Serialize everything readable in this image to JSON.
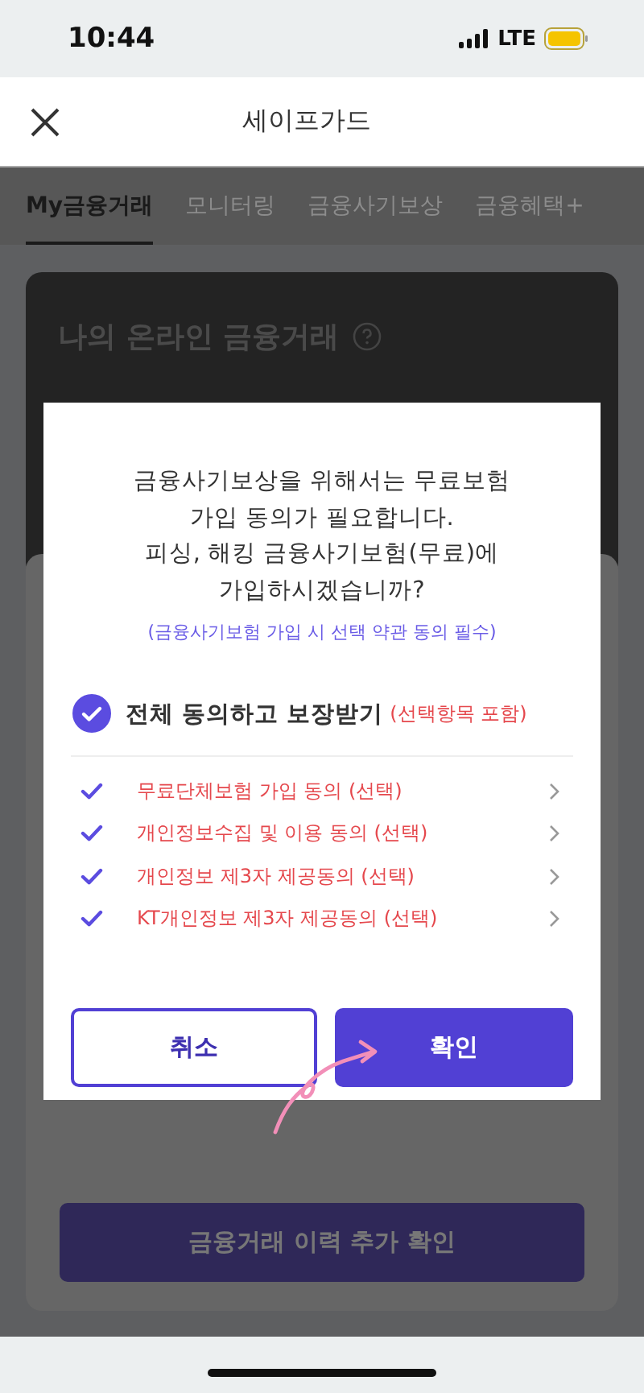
{
  "status_bar": {
    "time": "10:44",
    "network": "LTE"
  },
  "header": {
    "title": "세이프가드"
  },
  "tabs": [
    {
      "label": "My금융거래",
      "selected": true
    },
    {
      "label": "모니터링",
      "selected": false
    },
    {
      "label": "금융사기보상",
      "selected": false
    },
    {
      "label": "금융혜택+",
      "selected": false
    }
  ],
  "card": {
    "title": "나의 온라인 금융거래"
  },
  "background_button": {
    "label": "금융거래 이력 추가 확인"
  },
  "dialog": {
    "message": [
      "금융사기보상을 위해서는 무료보험",
      "가입 동의가 필요합니다.",
      "피싱, 해킹 금융사기보험(무료)에",
      "가입하시겠습니까?"
    ],
    "note": "(금융사기보험 가입 시 선택 약관 동의 필수)",
    "agree_all": {
      "label": "전체 동의하고 보장받기",
      "note": "(선택항목 포함)",
      "checked": true
    },
    "items": [
      {
        "label": "무료단체보험 가입 동의 (선택)",
        "checked": true
      },
      {
        "label": "개인정보수집 및 이용 동의 (선택)",
        "checked": true
      },
      {
        "label": "개인정보 제3자 제공동의 (선택)",
        "checked": true
      },
      {
        "label": "KT개인정보 제3자 제공동의 (선택)",
        "checked": true
      }
    ],
    "cancel": "취소",
    "confirm": "확인"
  }
}
